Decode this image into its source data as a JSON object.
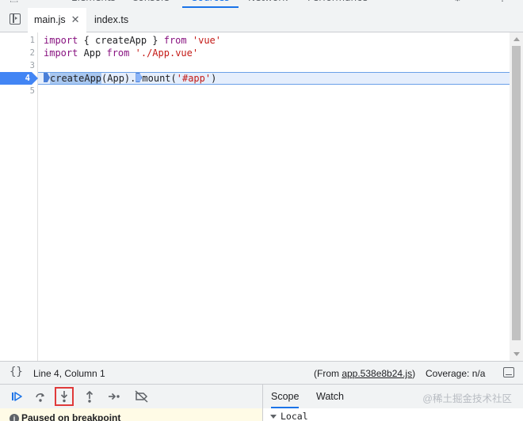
{
  "top_tabs": [
    "Elements",
    "Console",
    "Sources",
    "Network",
    "Performance"
  ],
  "top_tabs_active": "Sources",
  "file_tabs": [
    {
      "label": "main.js",
      "close": "✕"
    },
    {
      "label": "index.ts"
    }
  ],
  "editor": {
    "line_numbers": [
      "1",
      "2",
      "3",
      "4",
      "5"
    ],
    "line1": {
      "kw1": "import",
      "mid": " { createApp } ",
      "kw2": "from",
      "str": "'vue'"
    },
    "line2": {
      "kw1": "import",
      "mid": " App ",
      "kw2": "from",
      "str": "'./App.vue'"
    },
    "line4": {
      "sel": "createApp",
      "mid": "(App).",
      "call": "mount(",
      "str": "'#app'",
      "end": ")"
    },
    "breakpoint_line": "4"
  },
  "status": {
    "cursor": "Line 4, Column 1",
    "from_prefix": "(From ",
    "from_link": "app.538e8b24.js",
    "from_suffix": ")",
    "coverage": "Coverage: n/a"
  },
  "debugger": {
    "buttons": [
      "resume-icon",
      "step-over-icon",
      "step-into-icon",
      "step-out-icon",
      "step-icon",
      "deactivate-breakpoints-icon"
    ],
    "paused_message": "Paused on breakpoint"
  },
  "right_tabs": [
    "Scope",
    "Watch"
  ],
  "watermark": "@稀土掘金技术社区",
  "scope": {
    "local_label": "Local"
  },
  "colors": {
    "accent": "#1a73e8",
    "breakpoint": "#4285f4",
    "highlight_box": "#e03a3a"
  }
}
